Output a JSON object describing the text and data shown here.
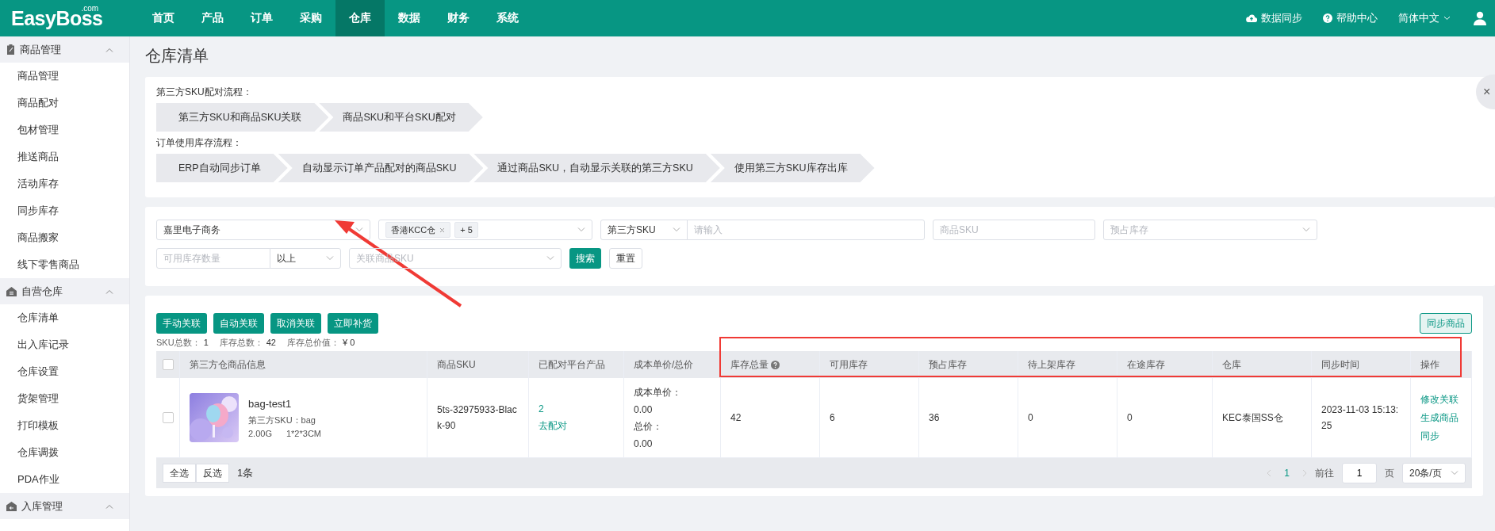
{
  "logo": {
    "text": "EasyBoss",
    "suffix": ".com"
  },
  "nav": [
    {
      "label": "首页",
      "selected": false
    },
    {
      "label": "产品",
      "selected": false
    },
    {
      "label": "订单",
      "selected": false
    },
    {
      "label": "采购",
      "selected": false
    },
    {
      "label": "仓库",
      "selected": true
    },
    {
      "label": "数据",
      "selected": false
    },
    {
      "label": "财务",
      "selected": false
    },
    {
      "label": "系统",
      "selected": false
    }
  ],
  "top_actions": [
    {
      "kind": "sync",
      "label": "数据同步"
    },
    {
      "kind": "help",
      "label": "帮助中心"
    },
    {
      "kind": "language",
      "label": "简体中文"
    }
  ],
  "sidebar": {
    "groups": [
      {
        "kind": "goods",
        "label": "商品管理",
        "expanded": true,
        "items": [
          "商品管理",
          "商品配对",
          "包材管理",
          "推送商品",
          "活动库存",
          "同步库存",
          "商品搬家",
          "线下零售商品"
        ]
      },
      {
        "kind": "warehouse",
        "label": "自营仓库",
        "expanded": true,
        "items": [
          "仓库清单",
          "出入库记录",
          "仓库设置",
          "货架管理",
          "打印模板",
          "仓库调拨",
          "PDA作业"
        ]
      },
      {
        "kind": "inbound",
        "label": "入库管理",
        "expanded": true
      }
    ]
  },
  "page_title": "仓库清单",
  "flow_card": {
    "close": "×",
    "flows": [
      {
        "title": "第三方SKU配对流程：",
        "steps": [
          "第三方SKU和商品SKU关联",
          "商品SKU和平台SKU配对"
        ]
      },
      {
        "title": "订单使用库存流程：",
        "steps": [
          "ERP自动同步订单",
          "自动显示订单产品配对的商品SKU",
          "通过商品SKU，自动显示关联的第三方SKU",
          "使用第三方SKU库存出库"
        ]
      }
    ]
  },
  "filters": {
    "shop": {
      "value": "嘉里电子商务"
    },
    "warehouse": {
      "tags": [
        "香港KCC仓"
      ],
      "more": "+ 5"
    },
    "sku_type": {
      "value": "第三方SKU"
    },
    "keyword": {
      "placeholder": "请输入"
    },
    "goods_sku": {
      "placeholder": "商品SKU"
    },
    "reserved": {
      "placeholder": "预占库存"
    },
    "available": {
      "placeholder": "可用库存数量"
    },
    "compare": {
      "value": "以上"
    },
    "linked_sku": {
      "placeholder": "关联商品SKU"
    },
    "search": "搜索",
    "reset": "重置"
  },
  "toolbar": {
    "buttons": [
      "手动关联",
      "自动关联",
      "取消关联",
      "立即补货"
    ],
    "sync": "同步商品"
  },
  "summary": [
    {
      "label": "SKU总数：",
      "value": "1"
    },
    {
      "label": "库存总数：",
      "value": "42"
    },
    {
      "label": "库存总价值：",
      "value": "¥ 0"
    }
  ],
  "table": {
    "header_checked": false,
    "columns": [
      {
        "label": "第三方仓商品信息",
        "help": false
      },
      {
        "label": "商品SKU",
        "help": false
      },
      {
        "label": "已配对平台产品",
        "help": false
      },
      {
        "label": "成本单价/总价",
        "help": false
      },
      {
        "label": "库存总量",
        "help": true
      },
      {
        "label": "可用库存",
        "help": false
      },
      {
        "label": "预占库存",
        "help": false
      },
      {
        "label": "待上架库存",
        "help": false
      },
      {
        "label": "在途库存",
        "help": false
      },
      {
        "label": "仓库",
        "help": false
      },
      {
        "label": "同步时间",
        "help": false
      },
      {
        "label": "操作",
        "help": false
      }
    ],
    "rows": [
      {
        "checked": false,
        "name": "bag-test1",
        "third_sku": "第三方SKU：bag",
        "weight": "2.00G",
        "size": "1*2*3CM",
        "goods_sku": "5ts-32975933-Black-90",
        "paired_count": "2",
        "pair_link": "去配对",
        "unit_cost_label": "成本单价：",
        "unit_cost": "0.00",
        "total_label": "总价：",
        "total": "0.00",
        "stock_total": "42",
        "available": "6",
        "reserved": "36",
        "pending": "0",
        "in_transit": "0",
        "warehouse": "KEC泰国SS仓",
        "sync_time": "2023-11-03 15:13:25",
        "actions": [
          "修改关联",
          "生成商品",
          "同步"
        ]
      }
    ]
  },
  "footer": {
    "select_all": "全选",
    "invert": "反选",
    "count": "1条"
  },
  "pagination": {
    "pages": [
      {
        "label": "1",
        "selected": true
      }
    ],
    "goto": "前往",
    "page_input": "1",
    "page_unit": "页",
    "size": "20条/页"
  }
}
